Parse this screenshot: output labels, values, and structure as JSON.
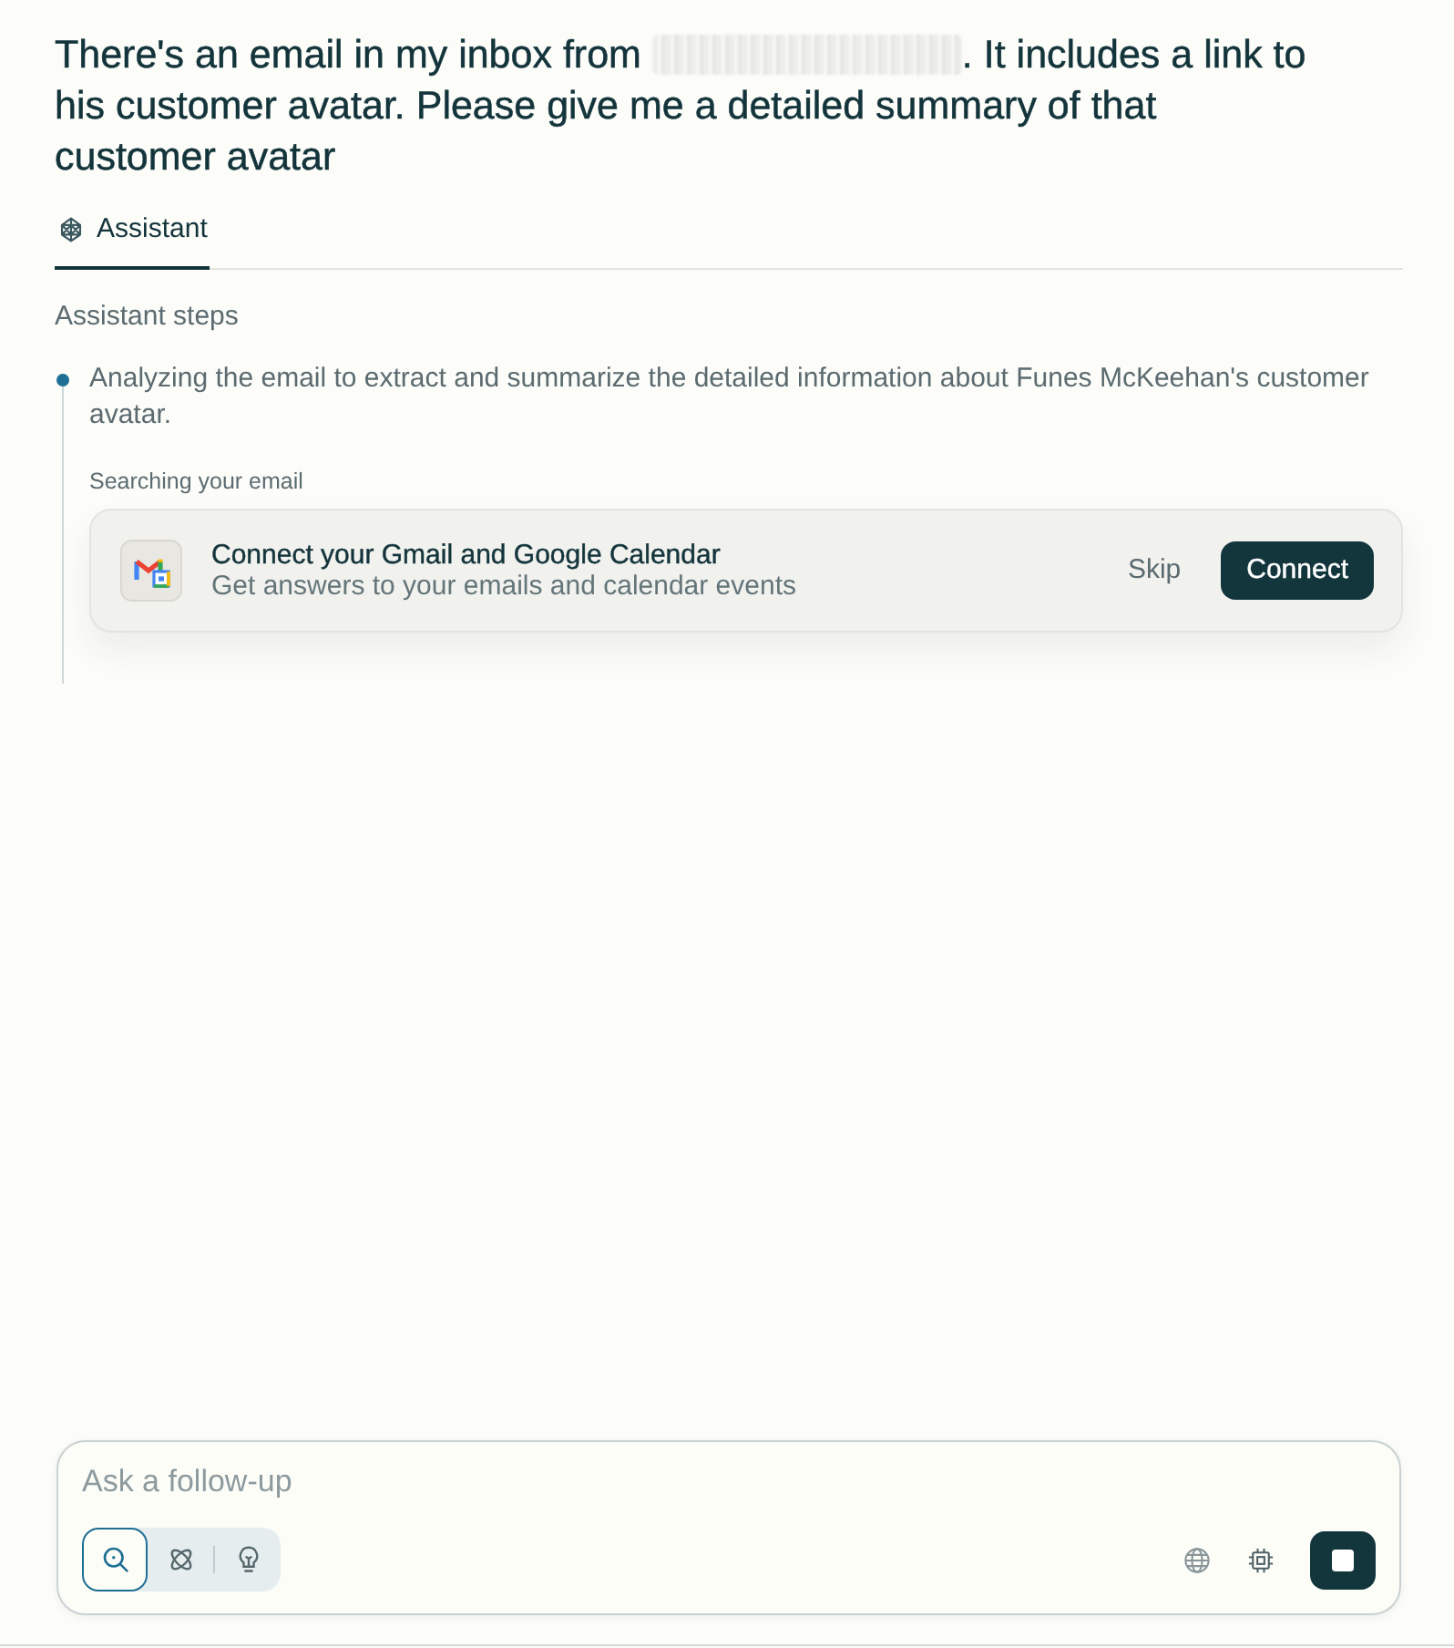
{
  "question": {
    "before": "There's an email in my inbox from",
    "redacted": true,
    "after": ". It includes a link to his customer avatar. Please give me a detailed summary of that customer avatar"
  },
  "tabs": [
    {
      "label": "Assistant",
      "selected": true
    }
  ],
  "steps_panel": {
    "title": "Assistant steps",
    "steps": [
      {
        "text": "Analyzing the email to extract and summarize the detailed information about Funes McKeehan's customer avatar.",
        "activity": {
          "label": "Searching your email",
          "card": {
            "title": "Connect your Gmail and Google Calendar",
            "subtitle": "Get answers to your emails and calendar events",
            "buttons": [
              {
                "label": "Skip",
                "kind": "text"
              },
              {
                "label": "Connect",
                "kind": "primary"
              }
            ]
          }
        }
      }
    ]
  },
  "composer": {
    "placeholder": "Ask a follow-up",
    "modes": [
      {
        "kind": "search",
        "selected": true
      },
      {
        "kind": "research",
        "selected": false
      },
      {
        "kind": "reasoning",
        "selected": false
      }
    ]
  }
}
